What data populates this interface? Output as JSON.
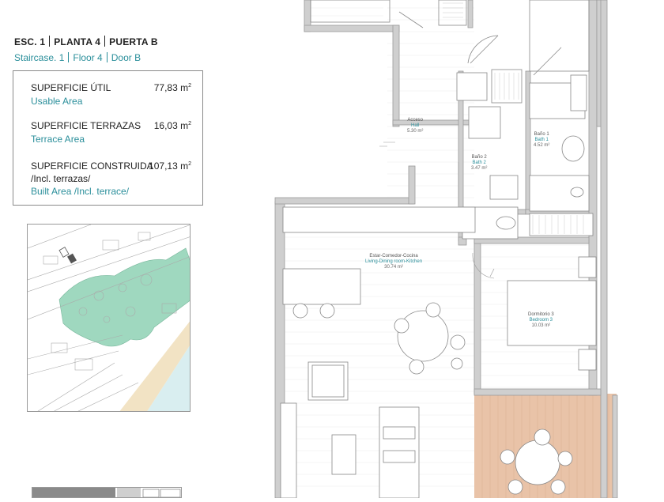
{
  "header": {
    "staircase_es": "ESC. 1",
    "floor_es": "PLANTA  4",
    "door_es": "PUERTA B",
    "staircase_en": "Staircase. 1",
    "floor_en": "Floor  4",
    "door_en": "Door B"
  },
  "areas": {
    "usable": {
      "es": "SUPERFICIE ÚTIL",
      "en": "Usable Area",
      "value": "77,83 m",
      "unit_sup": "2"
    },
    "terrace": {
      "es": "SUPERFICIE TERRAZAS",
      "en": "Terrace Area",
      "value": "16,03 m",
      "unit_sup": "2"
    },
    "built": {
      "es": "SUPERFICIE CONSTRUIDA",
      "es2": "/Incl. terrazas/",
      "en": "Built Area /Incl. terrace/",
      "value": "107,13 m",
      "unit_sup": "2"
    }
  },
  "rooms": {
    "hall": {
      "es": "Acceso",
      "en": "Hall",
      "area": "5.30 m²"
    },
    "bath1": {
      "es": "Baño 1",
      "en": "Bath 1",
      "area": "4.52 m²"
    },
    "bath2": {
      "es": "Baño 2",
      "en": "Bath 2",
      "area": "3.47 m²"
    },
    "living": {
      "es": "Estar-Comedor-Cocina",
      "en": "Living-Dining room-Kitchen",
      "area": "30.74 m²"
    },
    "bedroom3": {
      "es": "Dormitorio 3",
      "en": "Bedroom 3",
      "area": "10.03 m²"
    }
  },
  "colors": {
    "teal": "#2b8f9b",
    "park": "#9fd8bf",
    "beach": "#f2e3c4",
    "sea": "#d9eef0",
    "terrace": "#e9c3a8"
  }
}
